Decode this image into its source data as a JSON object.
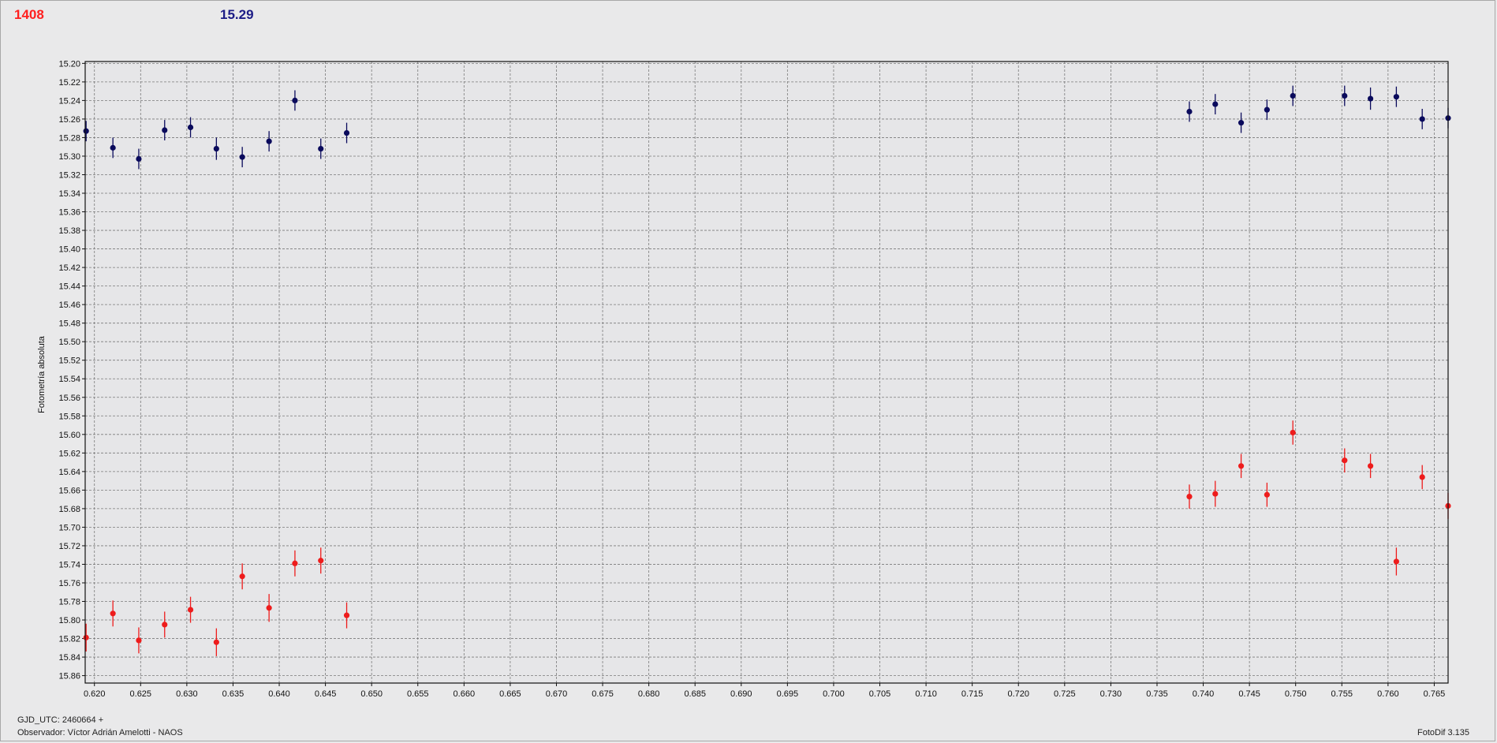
{
  "header": {
    "left_value": "1408",
    "right_value": "15.29"
  },
  "footer": {
    "gjd_line": "GJD_UTC: 2460664 +",
    "observer_line": "Observador: Víctor Adrián Amelotti - NAOS",
    "software": "FotoDif 3.135"
  },
  "colors": {
    "series_red": "#ee1c1c",
    "series_blue": "#0a0a5c",
    "background": "#e9e9ea",
    "grid": "#7a7a7a"
  },
  "chart_data": {
    "type": "scatter",
    "title": "",
    "xlabel": "",
    "ylabel": "Fotometría absoluta",
    "xlim": [
      0.619,
      0.7665
    ],
    "ylim": [
      15.198,
      15.868
    ],
    "y_inverted": true,
    "grid": true,
    "error_bars": true,
    "x_ticks": [
      "0.620",
      "0.625",
      "0.630",
      "0.635",
      "0.640",
      "0.645",
      "0.650",
      "0.655",
      "0.660",
      "0.665",
      "0.670",
      "0.675",
      "0.680",
      "0.685",
      "0.690",
      "0.695",
      "0.700",
      "0.705",
      "0.710",
      "0.715",
      "0.720",
      "0.725",
      "0.730",
      "0.735",
      "0.740",
      "0.745",
      "0.750",
      "0.755",
      "0.760",
      "0.765"
    ],
    "y_ticks": [
      "15.20",
      "15.22",
      "15.24",
      "15.26",
      "15.28",
      "15.30",
      "15.32",
      "15.34",
      "15.36",
      "15.38",
      "15.40",
      "15.42",
      "15.44",
      "15.46",
      "15.48",
      "15.50",
      "15.52",
      "15.54",
      "15.56",
      "15.58",
      "15.60",
      "15.62",
      "15.64",
      "15.66",
      "15.68",
      "15.70",
      "15.72",
      "15.74",
      "15.76",
      "15.78",
      "15.80",
      "15.82",
      "15.84",
      "15.86"
    ],
    "series": [
      {
        "color": "#0a0a5c",
        "points": [
          {
            "x": 0.6191,
            "y": 15.273,
            "err": 0.011
          },
          {
            "x": 0.622,
            "y": 15.291,
            "err": 0.011
          },
          {
            "x": 0.6248,
            "y": 15.303,
            "err": 0.011
          },
          {
            "x": 0.6276,
            "y": 15.272,
            "err": 0.011
          },
          {
            "x": 0.6304,
            "y": 15.269,
            "err": 0.011
          },
          {
            "x": 0.6332,
            "y": 15.292,
            "err": 0.012
          },
          {
            "x": 0.636,
            "y": 15.301,
            "err": 0.011
          },
          {
            "x": 0.6389,
            "y": 15.284,
            "err": 0.011
          },
          {
            "x": 0.6417,
            "y": 15.24,
            "err": 0.011
          },
          {
            "x": 0.6445,
            "y": 15.292,
            "err": 0.011
          },
          {
            "x": 0.6473,
            "y": 15.275,
            "err": 0.011
          },
          {
            "x": 0.7385,
            "y": 15.252,
            "err": 0.011
          },
          {
            "x": 0.7413,
            "y": 15.244,
            "err": 0.011
          },
          {
            "x": 0.7441,
            "y": 15.264,
            "err": 0.011
          },
          {
            "x": 0.7469,
            "y": 15.25,
            "err": 0.011
          },
          {
            "x": 0.7497,
            "y": 15.235,
            "err": 0.011
          },
          {
            "x": 0.7553,
            "y": 15.235,
            "err": 0.011
          },
          {
            "x": 0.7581,
            "y": 15.238,
            "err": 0.012
          },
          {
            "x": 0.7609,
            "y": 15.236,
            "err": 0.011
          },
          {
            "x": 0.7637,
            "y": 15.26,
            "err": 0.011
          },
          {
            "x": 0.7665,
            "y": 15.259,
            "err": 0.011
          }
        ]
      },
      {
        "color": "#ee1c1c",
        "points": [
          {
            "x": 0.6191,
            "y": 15.819,
            "err": 0.015
          },
          {
            "x": 0.622,
            "y": 15.793,
            "err": 0.014
          },
          {
            "x": 0.6248,
            "y": 15.822,
            "err": 0.014
          },
          {
            "x": 0.6276,
            "y": 15.805,
            "err": 0.014
          },
          {
            "x": 0.6304,
            "y": 15.789,
            "err": 0.014
          },
          {
            "x": 0.6332,
            "y": 15.824,
            "err": 0.015
          },
          {
            "x": 0.636,
            "y": 15.753,
            "err": 0.014
          },
          {
            "x": 0.6389,
            "y": 15.787,
            "err": 0.015
          },
          {
            "x": 0.6417,
            "y": 15.739,
            "err": 0.014
          },
          {
            "x": 0.6445,
            "y": 15.736,
            "err": 0.014
          },
          {
            "x": 0.6473,
            "y": 15.795,
            "err": 0.014
          },
          {
            "x": 0.7385,
            "y": 15.667,
            "err": 0.013
          },
          {
            "x": 0.7413,
            "y": 15.664,
            "err": 0.014
          },
          {
            "x": 0.7441,
            "y": 15.634,
            "err": 0.013
          },
          {
            "x": 0.7469,
            "y": 15.665,
            "err": 0.013
          },
          {
            "x": 0.7497,
            "y": 15.598,
            "err": 0.013
          },
          {
            "x": 0.7553,
            "y": 15.628,
            "err": 0.013
          },
          {
            "x": 0.7581,
            "y": 15.634,
            "err": 0.013
          },
          {
            "x": 0.7609,
            "y": 15.737,
            "err": 0.015
          },
          {
            "x": 0.7637,
            "y": 15.646,
            "err": 0.013
          },
          {
            "x": 0.7665,
            "y": 15.677,
            "err": 0.014
          }
        ]
      }
    ]
  }
}
